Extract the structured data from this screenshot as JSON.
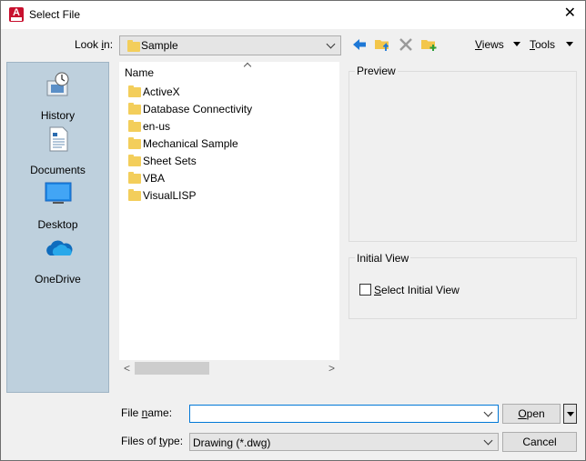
{
  "window": {
    "title": "Select File",
    "icon": "autocad-app-icon",
    "app_letter": "A"
  },
  "lookin": {
    "label_pre": "Look ",
    "label_accel": "i",
    "label_post": "n:",
    "value": "Sample"
  },
  "toolbar": {
    "views_accel": "V",
    "views_rest": "iews",
    "tools_accel": "T",
    "tools_rest": "ools",
    "back_icon": "back-arrow-icon",
    "up_icon": "up-one-level-folder-icon",
    "delete_icon": "delete-x-icon",
    "newfolder_icon": "new-folder-icon",
    "accent_color": "#0078d7"
  },
  "places": [
    {
      "label": "History",
      "icon": "history-icon"
    },
    {
      "label": "Documents",
      "icon": "documents-icon"
    },
    {
      "label": "Desktop",
      "icon": "desktop-icon"
    },
    {
      "label": "OneDrive",
      "icon": "onedrive-cloud-icon"
    }
  ],
  "file_list": {
    "column_header": "Name",
    "items": [
      "ActiveX",
      "Database Connectivity",
      "en-us",
      "Mechanical Sample",
      "Sheet Sets",
      "VBA",
      "VisualLISP"
    ]
  },
  "preview": {
    "label": "Preview"
  },
  "initial_view": {
    "label": "Initial View",
    "checkbox_accel": "S",
    "checkbox_rest": "elect Initial View",
    "checked": false
  },
  "filename": {
    "label_pre": "File ",
    "label_accel": "n",
    "label_post": "ame:",
    "value": ""
  },
  "filetype": {
    "label_pre": "Files of ",
    "label_accel": "t",
    "label_post": "ype:",
    "value": "Drawing (*.dwg)"
  },
  "buttons": {
    "open_accel": "O",
    "open_rest": "pen",
    "cancel": "Cancel"
  }
}
